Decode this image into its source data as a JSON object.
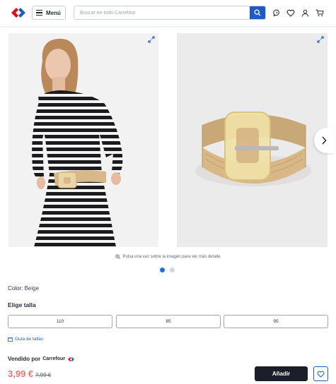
{
  "header": {
    "menu_label": "Menú",
    "search_placeholder": "Buscar en todo Carrefour"
  },
  "gallery": {
    "zoom_hint": "Pulsa una vez sobre la imagen para ver más detalle",
    "active_index": 0,
    "image_count": 2
  },
  "product": {
    "color_label": "Color:",
    "color_value": "Beige",
    "size_title": "Elige talla",
    "sizes": [
      "110",
      "85",
      "95"
    ],
    "size_guide": "Guía de tallas",
    "sold_by_label": "Vendido por",
    "seller": "Carrefour",
    "price": "3,99 €",
    "old_price": "7,99 €",
    "add_label": "Añadir"
  },
  "colors": {
    "brand_blue": "#1e5bc6",
    "brand_red": "#e30613",
    "price_red": "#e8727a",
    "button_dark": "#1a1f29"
  }
}
